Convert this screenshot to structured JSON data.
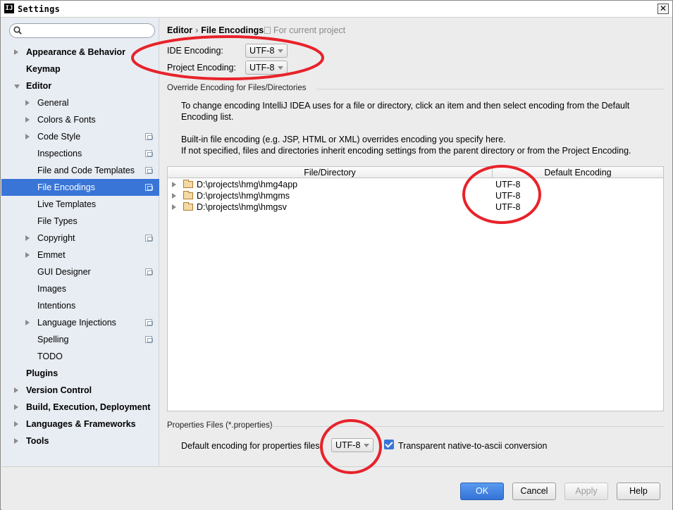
{
  "window": {
    "title": "Settings",
    "app_icon": "IJ",
    "close_glyph": "✕"
  },
  "search": {
    "placeholder": "",
    "value": ""
  },
  "sidebar": {
    "items": [
      {
        "label": "Appearance & Behavior",
        "level": 0,
        "bold": true,
        "arrow": "collapsed",
        "project_icon": false,
        "selected": false
      },
      {
        "label": "Keymap",
        "level": 0,
        "bold": true,
        "arrow": "none",
        "project_icon": false,
        "selected": false
      },
      {
        "label": "Editor",
        "level": 0,
        "bold": true,
        "arrow": "expanded",
        "project_icon": false,
        "selected": false
      },
      {
        "label": "General",
        "level": 1,
        "bold": false,
        "arrow": "collapsed",
        "project_icon": false,
        "selected": false
      },
      {
        "label": "Colors & Fonts",
        "level": 1,
        "bold": false,
        "arrow": "collapsed",
        "project_icon": false,
        "selected": false
      },
      {
        "label": "Code Style",
        "level": 1,
        "bold": false,
        "arrow": "collapsed",
        "project_icon": true,
        "selected": false
      },
      {
        "label": "Inspections",
        "level": 1,
        "bold": false,
        "arrow": "none",
        "project_icon": true,
        "selected": false
      },
      {
        "label": "File and Code Templates",
        "level": 1,
        "bold": false,
        "arrow": "none",
        "project_icon": true,
        "selected": false
      },
      {
        "label": "File Encodings",
        "level": 1,
        "bold": false,
        "arrow": "none",
        "project_icon": true,
        "selected": true
      },
      {
        "label": "Live Templates",
        "level": 1,
        "bold": false,
        "arrow": "none",
        "project_icon": false,
        "selected": false
      },
      {
        "label": "File Types",
        "level": 1,
        "bold": false,
        "arrow": "none",
        "project_icon": false,
        "selected": false
      },
      {
        "label": "Copyright",
        "level": 1,
        "bold": false,
        "arrow": "collapsed",
        "project_icon": true,
        "selected": false
      },
      {
        "label": "Emmet",
        "level": 1,
        "bold": false,
        "arrow": "collapsed",
        "project_icon": false,
        "selected": false
      },
      {
        "label": "GUI Designer",
        "level": 1,
        "bold": false,
        "arrow": "none",
        "project_icon": true,
        "selected": false
      },
      {
        "label": "Images",
        "level": 1,
        "bold": false,
        "arrow": "none",
        "project_icon": false,
        "selected": false
      },
      {
        "label": "Intentions",
        "level": 1,
        "bold": false,
        "arrow": "none",
        "project_icon": false,
        "selected": false
      },
      {
        "label": "Language Injections",
        "level": 1,
        "bold": false,
        "arrow": "collapsed",
        "project_icon": true,
        "selected": false
      },
      {
        "label": "Spelling",
        "level": 1,
        "bold": false,
        "arrow": "none",
        "project_icon": true,
        "selected": false
      },
      {
        "label": "TODO",
        "level": 1,
        "bold": false,
        "arrow": "none",
        "project_icon": false,
        "selected": false
      },
      {
        "label": "Plugins",
        "level": 0,
        "bold": true,
        "arrow": "none",
        "project_icon": false,
        "selected": false
      },
      {
        "label": "Version Control",
        "level": 0,
        "bold": true,
        "arrow": "collapsed",
        "project_icon": false,
        "selected": false
      },
      {
        "label": "Build, Execution, Deployment",
        "level": 0,
        "bold": true,
        "arrow": "collapsed",
        "project_icon": false,
        "selected": false
      },
      {
        "label": "Languages & Frameworks",
        "level": 0,
        "bold": true,
        "arrow": "collapsed",
        "project_icon": false,
        "selected": false
      },
      {
        "label": "Tools",
        "level": 0,
        "bold": true,
        "arrow": "collapsed",
        "project_icon": false,
        "selected": false
      }
    ]
  },
  "breadcrumb": {
    "parent": "Editor",
    "separator": "›",
    "current": "File Encodings",
    "scope": "For current project"
  },
  "encoding": {
    "ide_label": "IDE Encoding:",
    "ide_value": "UTF-8",
    "project_label": "Project Encoding:",
    "project_value": "UTF-8"
  },
  "override": {
    "title": "Override Encoding for Files/Directories",
    "desc1": "To change encoding IntelliJ IDEA uses for a file or directory, click an item and then select encoding from the Default Encoding list.",
    "desc2": "Built-in file encoding (e.g. JSP, HTML or XML) overrides encoding you specify here.",
    "desc3": "If not specified, files and directories inherit encoding settings from the parent directory or from the Project Encoding.",
    "columns": {
      "path": "File/Directory",
      "encoding": "Default Encoding"
    },
    "rows": [
      {
        "path": "D:\\projects\\hmg\\hmg4app",
        "encoding": "UTF-8"
      },
      {
        "path": "D:\\projects\\hmg\\hmgms",
        "encoding": "UTF-8"
      },
      {
        "path": "D:\\projects\\hmg\\hmgsv",
        "encoding": "UTF-8"
      }
    ]
  },
  "properties": {
    "title": "Properties Files (*.properties)",
    "label": "Default encoding for properties files:",
    "value": "UTF-8",
    "native_to_ascii_label": "Transparent native-to-ascii conversion",
    "native_to_ascii_checked": true
  },
  "buttons": {
    "ok": "OK",
    "cancel": "Cancel",
    "apply": "Apply",
    "help": "Help"
  },
  "colors": {
    "selection": "#3875d7",
    "annotation": "#e8222a",
    "sidebar_bg": "#e8edf3"
  }
}
